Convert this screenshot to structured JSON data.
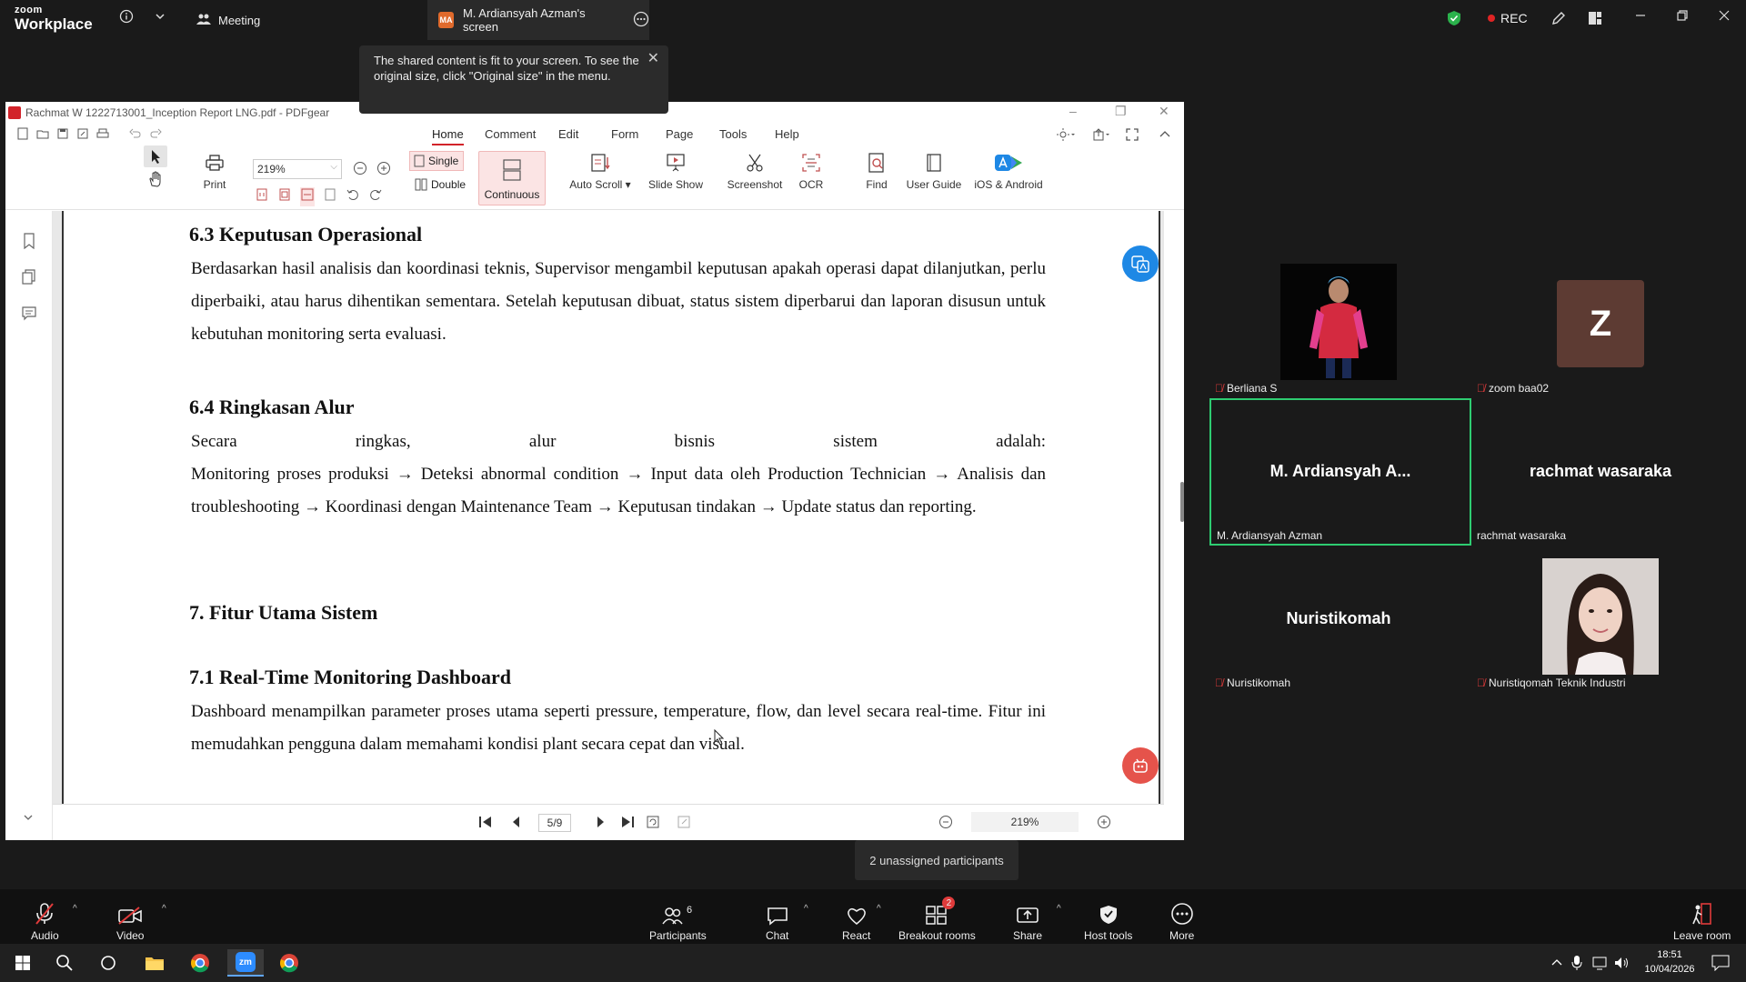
{
  "zoom": {
    "brand_top": "zoom",
    "brand_bottom": "Workplace",
    "meeting_label": "Meeting",
    "share_badge": "MA",
    "share_tab_label": "M. Ardiansyah Azman's screen",
    "rec_label": "REC"
  },
  "tooltip": {
    "text": "The shared content is fit to your screen. To see the original size, click \"Original size\" in the menu."
  },
  "pdf": {
    "window_title": "Rachmat W 1222713001_Inception Report LNG.pdf - PDFgear",
    "menu": [
      "Home",
      "Comment",
      "Edit",
      "Form",
      "Page",
      "Tools",
      "Help"
    ],
    "zoom_combo_value": "219%",
    "ribbon": {
      "print": "Print",
      "single": "Single",
      "double": "Double",
      "continuous": "Continuous",
      "auto_scroll": "Auto Scroll",
      "slide_show": "Slide Show",
      "screenshot": "Screenshot",
      "ocr": "OCR",
      "find": "Find",
      "user_guide": "User Guide",
      "ios_android": "iOS & Android"
    },
    "content": {
      "h63": "6.3 Keputusan Operasional",
      "p63": "Berdasarkan hasil analisis dan koordinasi teknis, Supervisor mengambil keputusan apakah operasi dapat dilanjutkan, perlu diperbaiki, atau harus dihentikan sementara. Setelah keputusan dibuat, status sistem diperbarui dan laporan disusun untuk kebutuhan monitoring serta evaluasi.",
      "h64": "6.4 Ringkasan Alur",
      "p64a": "Secara ringkas, alur bisnis sistem adalah:",
      "p64b": "Monitoring proses produksi → Deteksi abnormal condition → Input data oleh Production Technician → Analisis dan troubleshooting → Koordinasi dengan Maintenance Team → Keputusan tindakan → Update status dan reporting.",
      "h7": "7. Fitur Utama Sistem",
      "h71": "7.1 Real-Time Monitoring Dashboard",
      "p71": "Dashboard menampilkan parameter proses utama seperti pressure, temperature, flow, dan level secara real-time. Fitur ini memudahkan pengguna dalam memahami kondisi plant secara cepat dan visual."
    },
    "status": {
      "page_indicator": "5/9",
      "zoom_value": "219%"
    }
  },
  "participants": {
    "tiles": [
      {
        "name": "Berliana S"
      },
      {
        "name": "zoom baa02",
        "initial": "Z"
      },
      {
        "name": "M. Ardiansyah Azman",
        "display": "M. Ardiansyah A..."
      },
      {
        "name": "rachmat wasaraka",
        "display": "rachmat wasaraka"
      },
      {
        "name": "Nuristikomah",
        "display": "Nuristikomah"
      },
      {
        "name": "Nuristiqomah Teknik Industri"
      }
    ],
    "hint": "2 unassigned participants"
  },
  "toolbar": {
    "audio": "Audio",
    "video": "Video",
    "participants": "Participants",
    "participants_count": "6",
    "chat": "Chat",
    "react": "React",
    "breakout": "Breakout rooms",
    "breakout_badge": "2",
    "share": "Share",
    "host_tools": "Host tools",
    "more": "More",
    "leave": "Leave room"
  },
  "taskbar": {
    "time": "18:51",
    "date": "10/04/2026",
    "zoom_badge": "zm"
  },
  "colors": {
    "zoom_bg": "#1a1a1a",
    "accent_red": "#d2232a",
    "speaker_border": "#2ecc71",
    "shield_green": "#2bb24c",
    "zoom_initial_bg": "#5d3b33"
  }
}
